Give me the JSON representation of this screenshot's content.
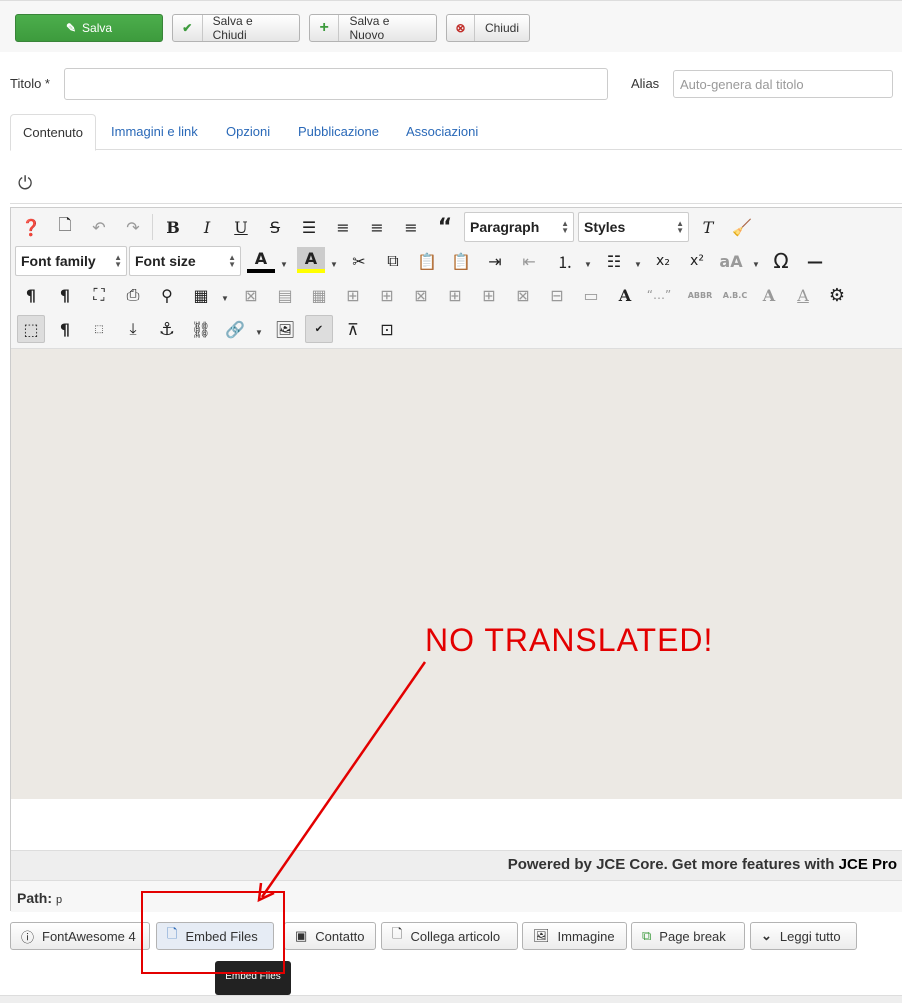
{
  "toolbar": {
    "save": "Salva",
    "save_close": "Salva e Chiudi",
    "save_new": "Salva e Nuovo",
    "close": "Chiudi"
  },
  "form": {
    "title_label": "Titolo *",
    "title_value": "",
    "alias_label": "Alias",
    "alias_placeholder": "Auto-genera dal titolo"
  },
  "tabs": [
    "Contenuto",
    "Immagini e link",
    "Opzioni",
    "Pubblicazione",
    "Associazioni"
  ],
  "editor": {
    "format_select": "Paragraph",
    "styles_select": "Styles",
    "font_family_select": "Font family",
    "font_size_select": "Font size",
    "powered_prefix": "Powered by JCE Core. Get more features with ",
    "powered_link": "JCE Pro",
    "path_label": "Path:",
    "path_value": "p"
  },
  "extension_buttons": [
    "FontAwesome 4",
    "Embed Files",
    "Contatto",
    "Collega articolo",
    "Immagine",
    "Page break",
    "Leggi tutto"
  ],
  "tooltip": "Embed Files",
  "annotation": "NO TRANSLATED!",
  "colors": {
    "accent": "#2a69b8",
    "save_green": "#4cae4c",
    "annotation_red": "#e30000",
    "editor_bg": "#ece9e4"
  }
}
